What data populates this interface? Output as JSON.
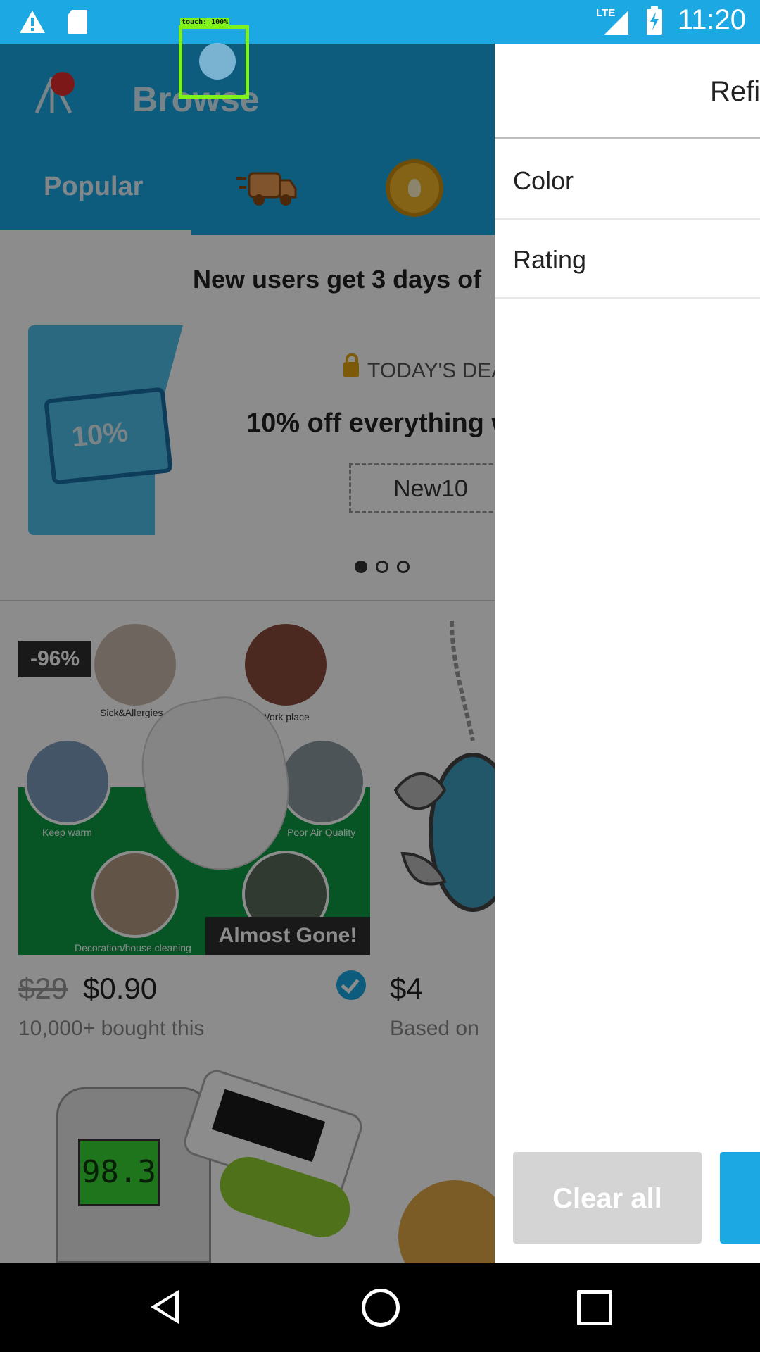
{
  "status_bar": {
    "time": "11:20",
    "network": "LTE",
    "icons": [
      "warning-icon",
      "sd-card-icon",
      "signal-icon",
      "battery-charging-icon"
    ]
  },
  "header": {
    "title": "Browse",
    "logo_icon": "wish-logo-icon"
  },
  "tabs": [
    {
      "label": "Popular",
      "selected": true
    },
    {
      "icon": "fast-delivery-truck-icon"
    },
    {
      "icon": "coin-icon"
    }
  ],
  "promo": {
    "headline": "New users get 3 days of",
    "deal_label": "TODAY'S DEA",
    "deal_text": "10% off everything w",
    "coupon_code": "New10",
    "ticket_text": "10%",
    "carousel_pages": 3,
    "carousel_active": 0
  },
  "products": [
    {
      "badge": "-96%",
      "overlay": "Almost Gone!",
      "old_price": "$29",
      "price": "$0.90",
      "meta": "10,000+ bought this",
      "captions": [
        "Sick&Allergies",
        "Work place",
        "Keep warm",
        "Poor Air Quality",
        "Decoration/house cleaning"
      ]
    },
    {
      "price": "$4",
      "meta": "Based on"
    },
    {
      "screen": "98.3"
    }
  ],
  "drawer": {
    "title": "Refi",
    "filters": [
      "Color",
      "Rating"
    ],
    "clear_label": "Clear all"
  },
  "touch_indicator": {
    "label": "touch: 100%"
  },
  "colors": {
    "brand_blue": "#1ba8e3",
    "touch_green": "#7ef21a"
  }
}
